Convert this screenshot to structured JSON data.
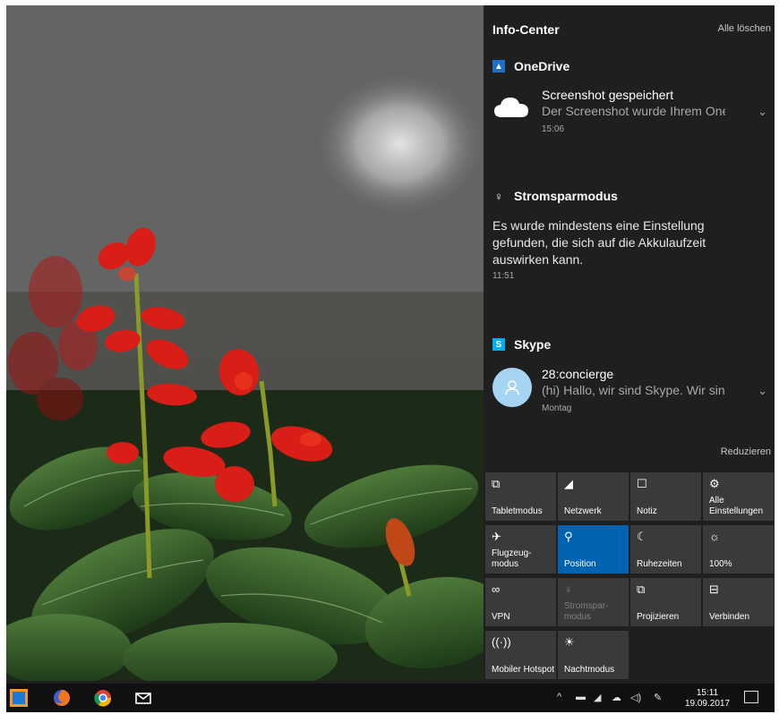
{
  "action_center": {
    "title": "Info-Center",
    "clear_all": "Alle löschen",
    "collapse": "Reduzieren",
    "groups": {
      "onedrive": {
        "app": "OneDrive",
        "title": "Screenshot gespeichert",
        "text": "Der Screenshot wurde Ihrem OneDrive hinzugefügt",
        "time": "15:06"
      },
      "power": {
        "app": "Stromsparmodus",
        "text": "Es wurde mindestens eine Einstellung gefunden, die sich auf die Akkulaufzeit auswirken kann.",
        "time": "11:51"
      },
      "skype": {
        "app": "Skype",
        "title": "28:concierge",
        "text": "(hi) Hallo, wir sind Skype. Wir sind hier",
        "time": "Montag"
      }
    },
    "quick_actions": [
      {
        "label": "Tabletmodus",
        "icon": "tablet-mode-icon",
        "glyph": "⧉"
      },
      {
        "label": "Netzwerk",
        "icon": "network-icon",
        "glyph": "◢"
      },
      {
        "label": "Notiz",
        "icon": "note-icon",
        "glyph": "☐"
      },
      {
        "label": "Alle Einstellungen",
        "icon": "settings-gear-icon",
        "glyph": "⚙"
      },
      {
        "label": "Flugzeug-modus",
        "icon": "airplane-icon",
        "glyph": "✈"
      },
      {
        "label": "Position",
        "icon": "location-icon",
        "glyph": "⚲",
        "active": true
      },
      {
        "label": "Ruhezeiten",
        "icon": "moon-icon",
        "glyph": "☾"
      },
      {
        "label": "100%",
        "icon": "brightness-icon",
        "glyph": "☼"
      },
      {
        "label": "VPN",
        "icon": "vpn-icon",
        "glyph": "∞"
      },
      {
        "label": "Stromspar-modus",
        "icon": "battery-saver-icon",
        "glyph": "♀",
        "disabled": true
      },
      {
        "label": "Projizieren",
        "icon": "project-icon",
        "glyph": "⧉"
      },
      {
        "label": "Verbinden",
        "icon": "connect-icon",
        "glyph": "⊟"
      },
      {
        "label": "Mobiler Hotspot",
        "icon": "hotspot-icon",
        "glyph": "((·))"
      },
      {
        "label": "Nachtmodus",
        "icon": "night-light-icon",
        "glyph": "☀"
      }
    ]
  },
  "taskbar": {
    "clock_time": "15:11",
    "clock_date": "19.09.2017"
  },
  "colors": {
    "accent": "#0063b1",
    "panel": "#1f1f1f",
    "tile": "#3a3a3a"
  }
}
